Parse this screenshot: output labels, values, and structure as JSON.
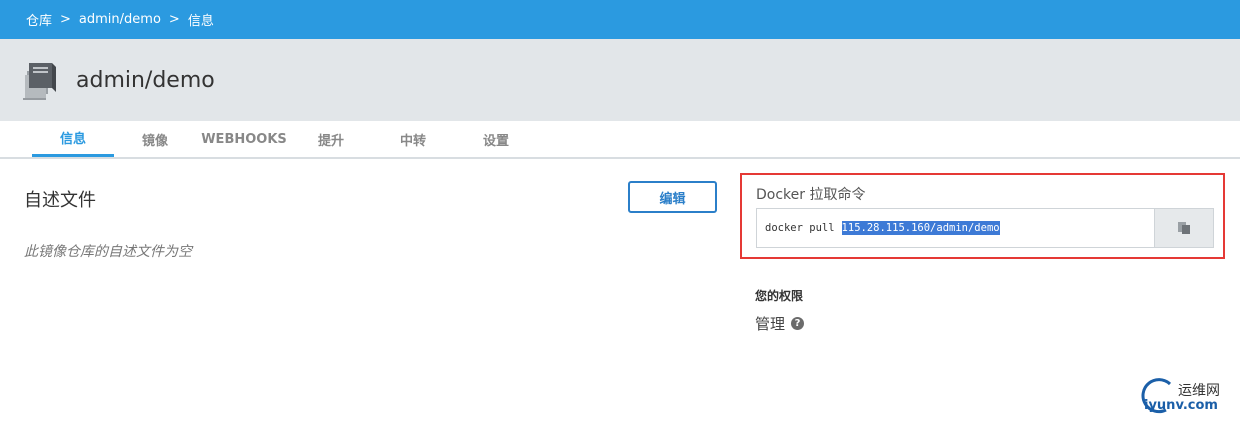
{
  "breadcrumb": {
    "root": "仓库",
    "sep": ">",
    "repo": "admin/demo",
    "current": "信息"
  },
  "repo": {
    "title": "admin/demo",
    "icon": "books-icon"
  },
  "tabs": [
    {
      "label": "信息",
      "active": true
    },
    {
      "label": "镜像",
      "active": false
    },
    {
      "label": "WEBHOOKS",
      "active": false
    },
    {
      "label": "提升",
      "active": false
    },
    {
      "label": "中转",
      "active": false
    },
    {
      "label": "设置",
      "active": false
    }
  ],
  "readme": {
    "title": "自述文件",
    "edit_label": "编辑",
    "empty_text": "此镜像仓库的自述文件为空"
  },
  "pull": {
    "title": "Docker 拉取命令",
    "command_prefix": "docker pull",
    "command_target": "115.28.115.160/admin/demo",
    "copy_icon": "copy-icon"
  },
  "permissions": {
    "title": "您的权限",
    "value": "管理",
    "help_icon": "question-circle-icon"
  },
  "watermark": {
    "cn": "运维网",
    "en": "iyunv.com"
  },
  "colors": {
    "primary": "#2b9ae0",
    "header_bg": "#e2e6e9",
    "highlight_border": "#e53935",
    "selection": "#3d7ad6"
  }
}
